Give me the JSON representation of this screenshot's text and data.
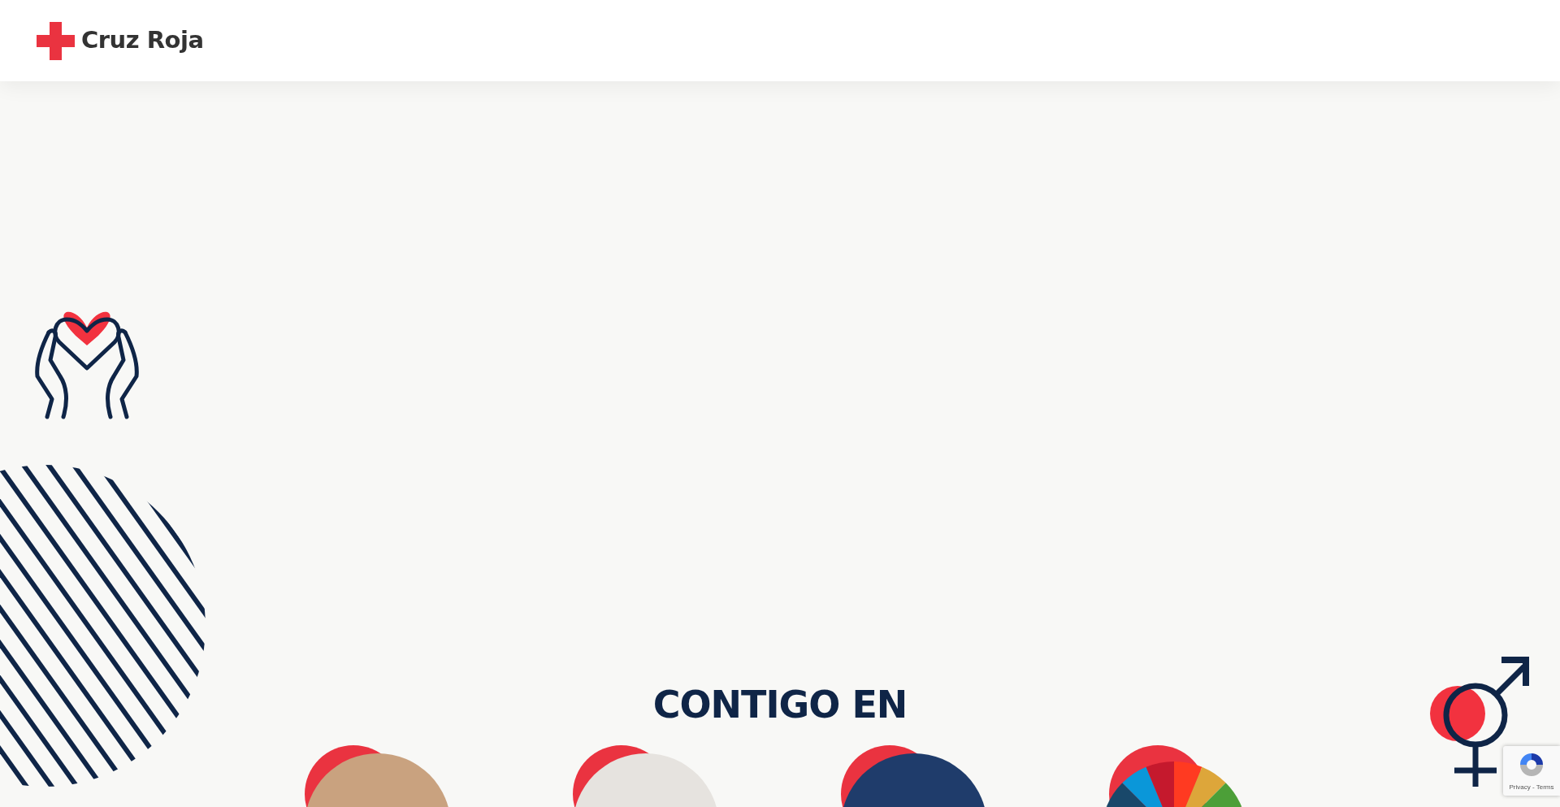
{
  "header": {
    "logo_text": "Cruz Roja"
  },
  "section": {
    "heading": "CONTIGO EN"
  },
  "categories": [
    {
      "kind": "photo"
    },
    {
      "kind": "photo"
    },
    {
      "kind": "photo"
    },
    {
      "kind": "wheel"
    }
  ],
  "recaptcha": {
    "links": "Privacy - Terms"
  }
}
